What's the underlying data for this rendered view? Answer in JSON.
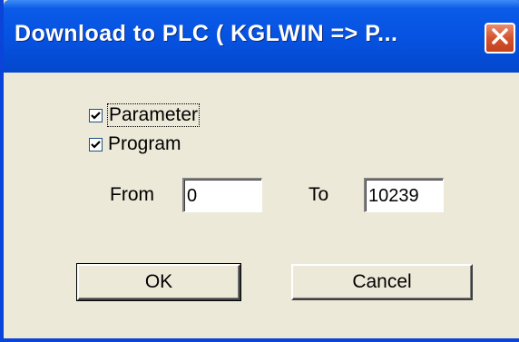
{
  "window": {
    "title": "Download to PLC ( KGLWIN => P...",
    "close_icon": "close-icon"
  },
  "options": {
    "parameter": {
      "label": "Parameter",
      "checked": true
    },
    "program": {
      "label": "Program",
      "checked": true
    }
  },
  "range": {
    "from_label": "From",
    "from_value": "0",
    "to_label": "To",
    "to_value": "10239"
  },
  "buttons": {
    "ok_label": "OK",
    "cancel_label": "Cancel"
  },
  "colors": {
    "titlebar": "#0652e0",
    "close_button": "#d4532d",
    "dialog_background": "#ece9d8"
  }
}
